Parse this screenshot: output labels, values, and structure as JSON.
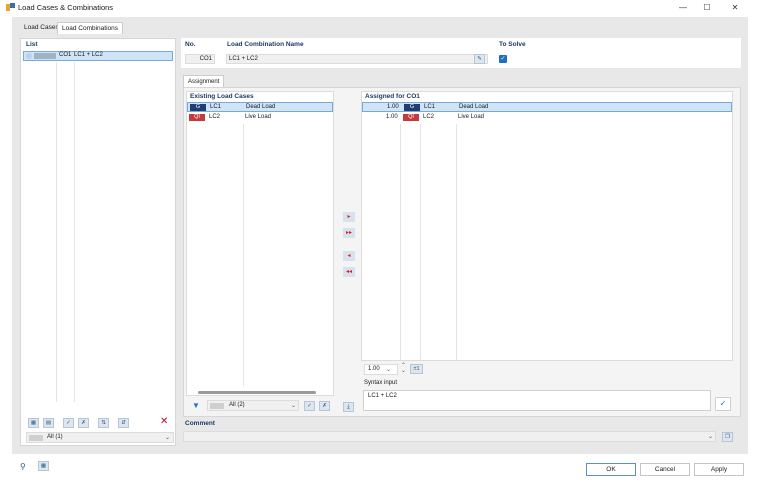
{
  "window": {
    "title": "Load Cases & Combinations"
  },
  "tabs": [
    "Load Cases",
    "Load Combinations"
  ],
  "list": {
    "header": "List",
    "items": [
      {
        "no": "CO1",
        "name": "LC1 + LC2"
      }
    ],
    "filter_value": "All (1)"
  },
  "detail": {
    "no_label": "No.",
    "no_value": "CO1",
    "name_label": "Load Combination Name",
    "name_value": "LC1 + LC2",
    "to_solve_label": "To Solve",
    "to_solve_checked": true
  },
  "assignment": {
    "tab_label": "Assignment",
    "existing_header": "Existing Load Cases",
    "existing": [
      {
        "badge": "G",
        "badge_type": "g",
        "id": "LC1",
        "name": "Dead Load"
      },
      {
        "badge": "QI A",
        "badge_type": "q",
        "id": "LC2",
        "name": "Live Load"
      }
    ],
    "assigned_header": "Assigned for CO1",
    "assigned": [
      {
        "factor": "1.00",
        "badge": "G",
        "badge_type": "g",
        "id": "LC1",
        "name": "Dead Load"
      },
      {
        "factor": "1.00",
        "badge": "QI A",
        "badge_type": "q",
        "id": "LC2",
        "name": "Live Load"
      }
    ],
    "filter_value": "All (2)",
    "factor_value": "1.00",
    "factor_button": "±1",
    "syntax_label": "Syntax input",
    "syntax_value": "LC1 + LC2"
  },
  "comment_label": "Comment",
  "buttons": {
    "ok": "OK",
    "cancel": "Cancel",
    "apply": "Apply"
  },
  "colors": {
    "accent": "#1f6fc1",
    "selection": "#cfe4f7",
    "badge_g": "#1f3e73",
    "badge_q": "#c43a3a"
  }
}
